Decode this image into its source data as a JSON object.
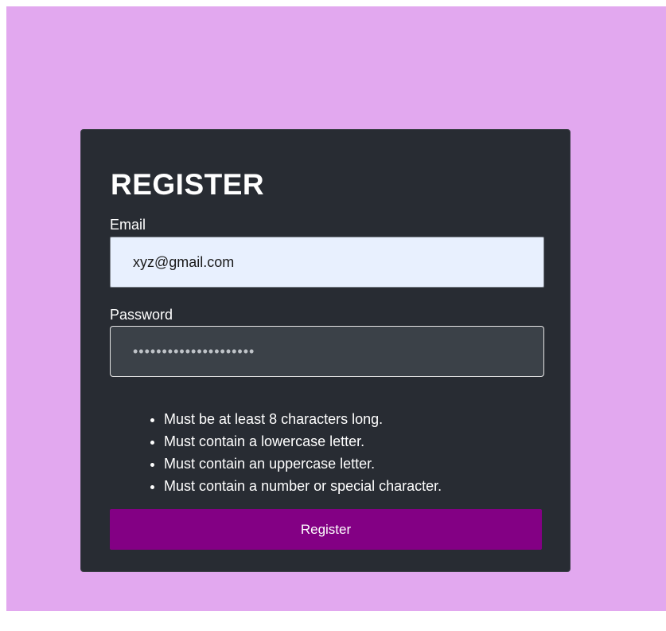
{
  "form": {
    "title": "REGISTER",
    "email_label": "Email",
    "email_value": "xyz@gmail.com",
    "password_label": "Password",
    "password_value": "•••••••••••••••••••••",
    "rules": [
      "Must be at least 8 characters long.",
      "Must contain a lowercase letter.",
      "Must contain an uppercase letter.",
      "Must contain a number or special character."
    ],
    "submit_label": "Register"
  },
  "colors": {
    "page_background": "#e2a8ef",
    "card_background": "#282c33",
    "button_background": "#830084",
    "email_field_background": "#e8f0fe",
    "password_field_background": "#3b4148"
  }
}
